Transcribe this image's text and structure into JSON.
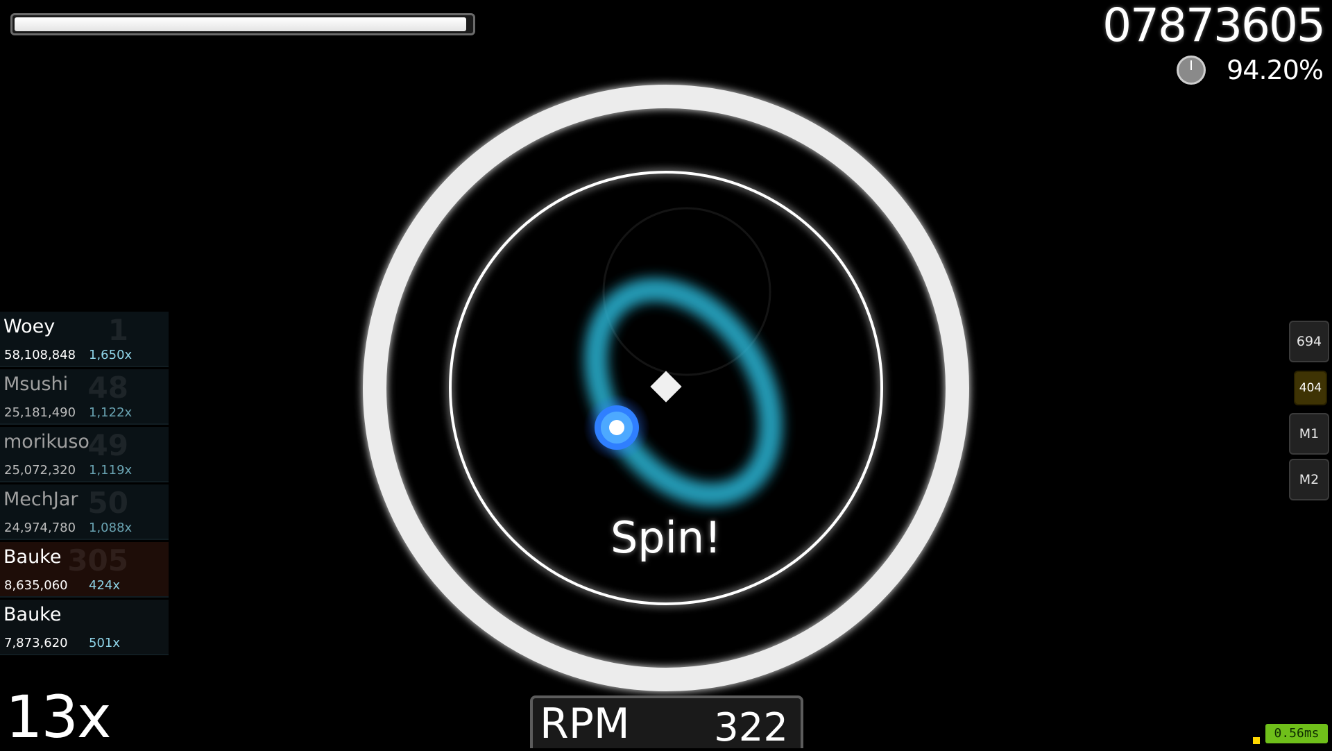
{
  "health": {
    "fraction": 0.99
  },
  "score": "07873605",
  "accuracy": "94.20%",
  "leaderboard": [
    {
      "rank": "1",
      "name": "Woey",
      "score": "58,108,848",
      "combo": "1,650x"
    },
    {
      "rank": "48",
      "name": "Msushi",
      "score": "25,181,490",
      "combo": "1,122x"
    },
    {
      "rank": "49",
      "name": "morikuso",
      "score": "25,072,320",
      "combo": "1,119x"
    },
    {
      "rank": "50",
      "name": "MechJar",
      "score": "24,974,780",
      "combo": "1,088x"
    },
    {
      "rank": "305",
      "name": "Bauke",
      "score": "8,635,060",
      "combo": "424x"
    },
    {
      "rank": "",
      "name": "Bauke",
      "score": "7,873,620",
      "combo": "501x"
    }
  ],
  "spinner": {
    "prompt": "Spin!"
  },
  "combo": "13x",
  "rpm": {
    "label": "RPM",
    "value": "322"
  },
  "keys": [
    {
      "label": "694"
    },
    {
      "label": "404"
    },
    {
      "label": "M1"
    },
    {
      "label": "M2"
    }
  ],
  "latency": "0.56ms",
  "colors": {
    "trail": "#2bb6d6",
    "cursor": "#2f7fff",
    "latency_bg": "#6fbf1a",
    "key_active": "#3e3304"
  }
}
